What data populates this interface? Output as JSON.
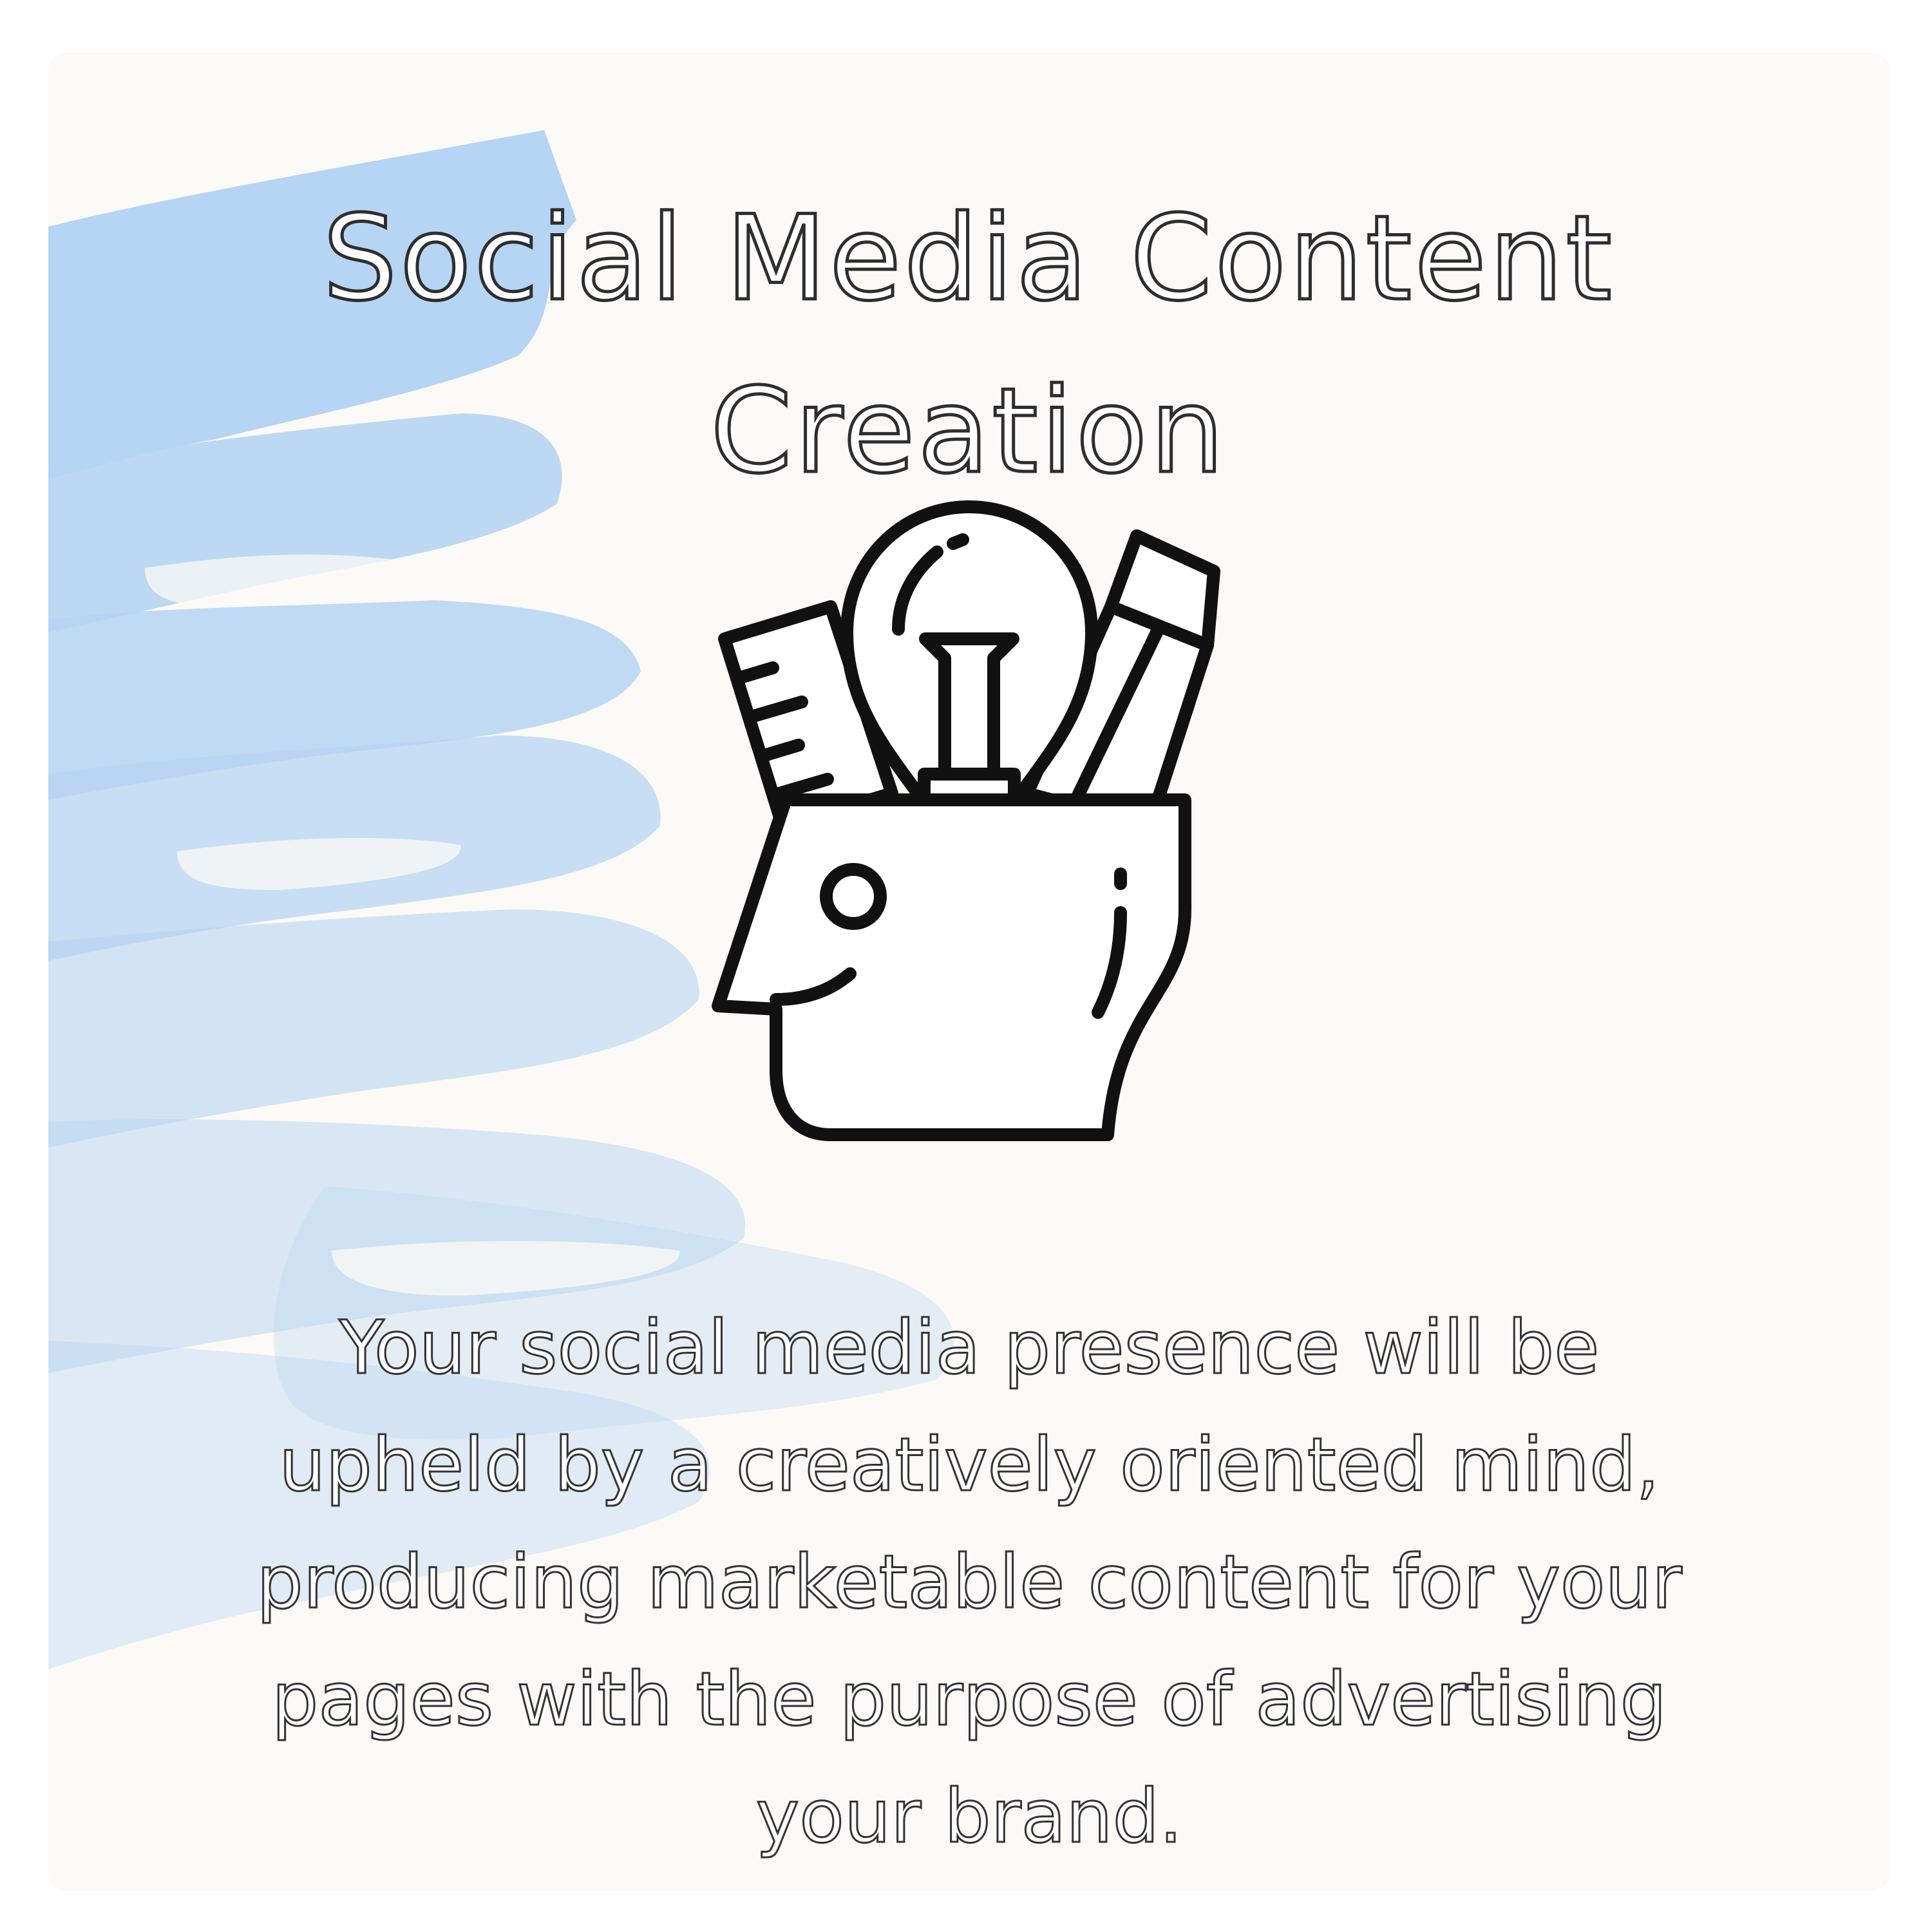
{
  "colors": {
    "background": "#fcfaf6",
    "watercolor": "#a9cdf2",
    "outline": "#2e2e2e",
    "icon_stroke": "#111111"
  },
  "title": "Social Media Content Creation",
  "icon": "head-with-lightbulb-ruler-pencil-icon",
  "description": "Your social media presence will be upheld by a creatively oriented mind, producing marketable content for your pages with the purpose of advertising your brand."
}
